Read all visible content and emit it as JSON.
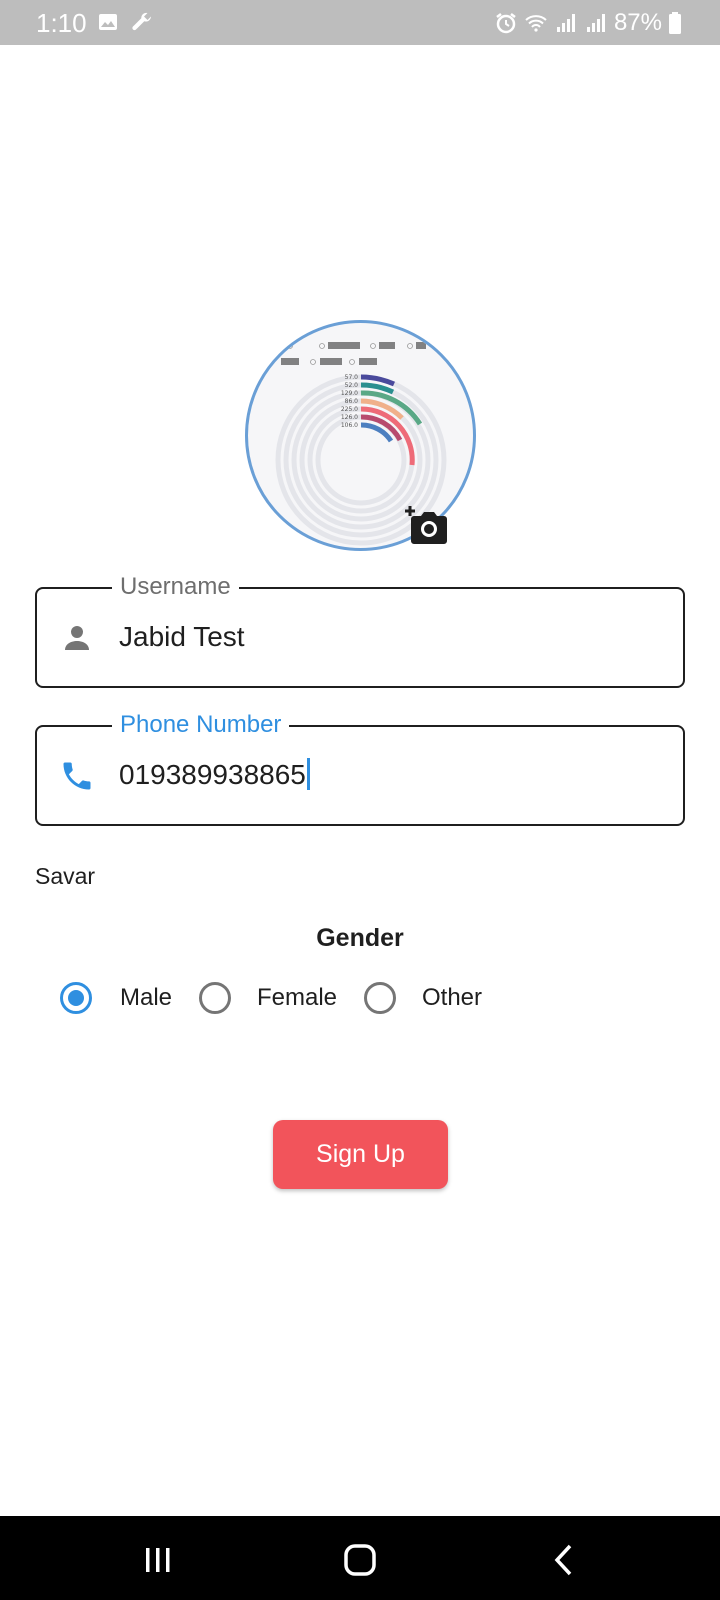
{
  "status_bar": {
    "time": "1:10",
    "battery": "87%",
    "icons": [
      "image-icon",
      "wrench-icon",
      "alarm-icon",
      "wifi-icon",
      "signal-icon",
      "signal-icon",
      "battery-icon"
    ]
  },
  "profile": {
    "avatar_icon": "profile-photo",
    "camera_icon": "add-photo-camera-icon"
  },
  "form": {
    "username_label": "Username",
    "username_value": "Jabid Test",
    "username_icon": "person-icon",
    "phone_label": "Phone Number",
    "phone_value": "019389938865",
    "phone_icon": "phone-icon",
    "location": "Savar",
    "gender_title": "Gender",
    "gender_options": [
      {
        "label": "Male",
        "selected": true
      },
      {
        "label": "Female",
        "selected": false
      },
      {
        "label": "Other",
        "selected": false
      }
    ],
    "signup_label": "Sign Up"
  },
  "colors": {
    "accent": "#2f8fe0",
    "signup_button": "#f2545b",
    "avatar_border": "#6a9fd6"
  },
  "nav_bar": {
    "buttons": [
      "recent-apps-icon",
      "home-icon",
      "back-icon"
    ]
  }
}
